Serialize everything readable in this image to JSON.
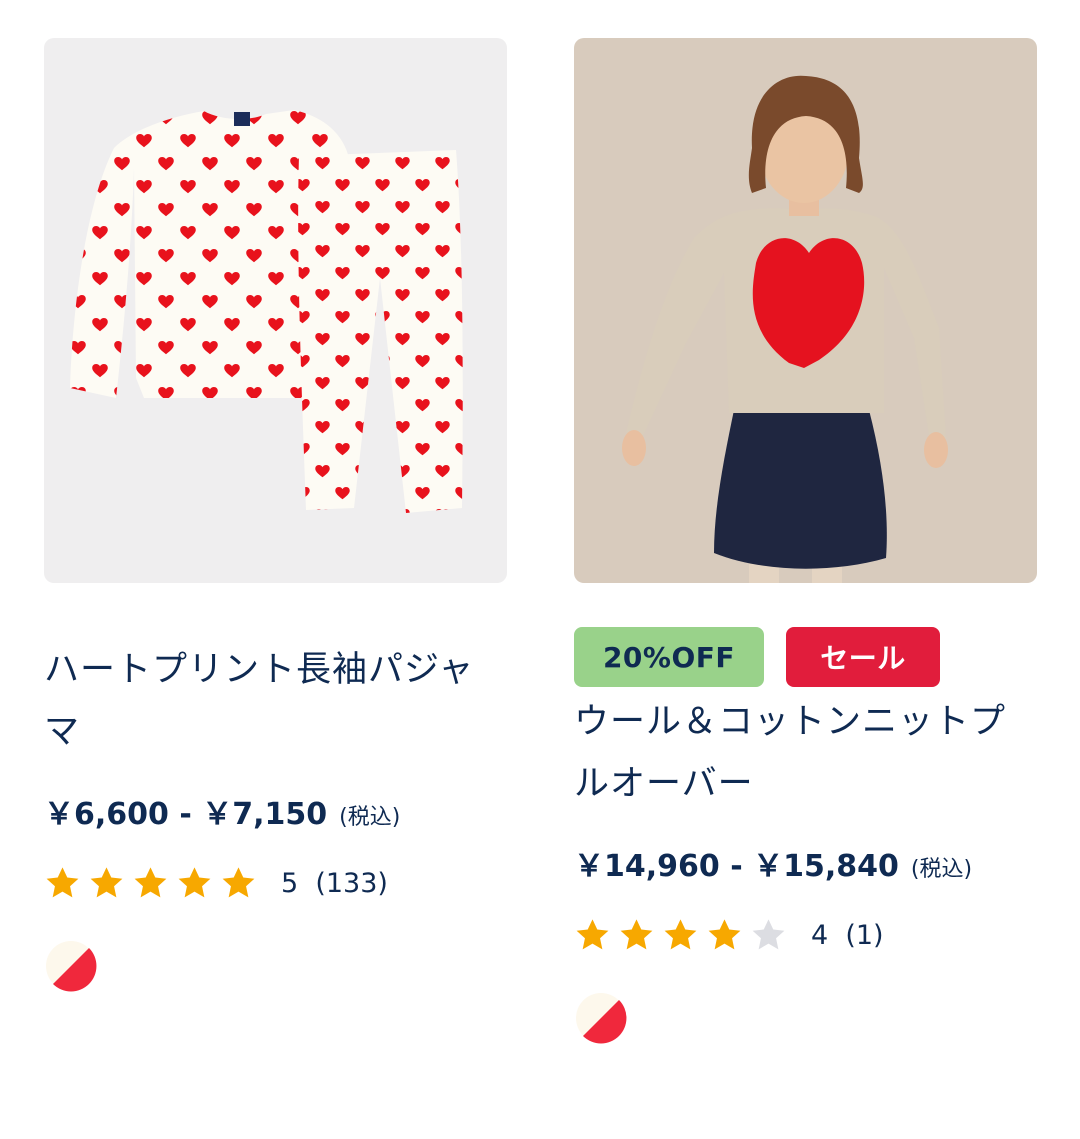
{
  "products": [
    {
      "name": "ハートプリント長袖パジャマ",
      "price_low": "￥6,600",
      "price_sep": " - ",
      "price_high": "￥7,150",
      "tax_label": "(税込)",
      "rating": 5,
      "rating_count_label": "5  (133)",
      "swatch_colors": [
        "#fdf8ec",
        "#f0283c"
      ],
      "image_alt": "ハートプリント長袖パジャマ"
    },
    {
      "name": "ウール＆コットンニットプルオーバー",
      "badges": {
        "discount": "20%OFF",
        "sale": "セール"
      },
      "price_low": "￥14,960",
      "price_sep": " - ",
      "price_high": "￥15,840",
      "tax_label": "(税込)",
      "rating": 4,
      "rating_count_label": "4  (1)",
      "swatch_colors": [
        "#fdf8ec",
        "#f0283c"
      ],
      "image_alt": "ウール＆コットンニットプルオーバー"
    }
  ],
  "colors": {
    "text_primary": "#0f2a52",
    "star_filled": "#f7a800",
    "star_empty": "#dcdde2",
    "badge_discount_bg": "#99d28a",
    "badge_sale_bg": "#e11d3c"
  }
}
